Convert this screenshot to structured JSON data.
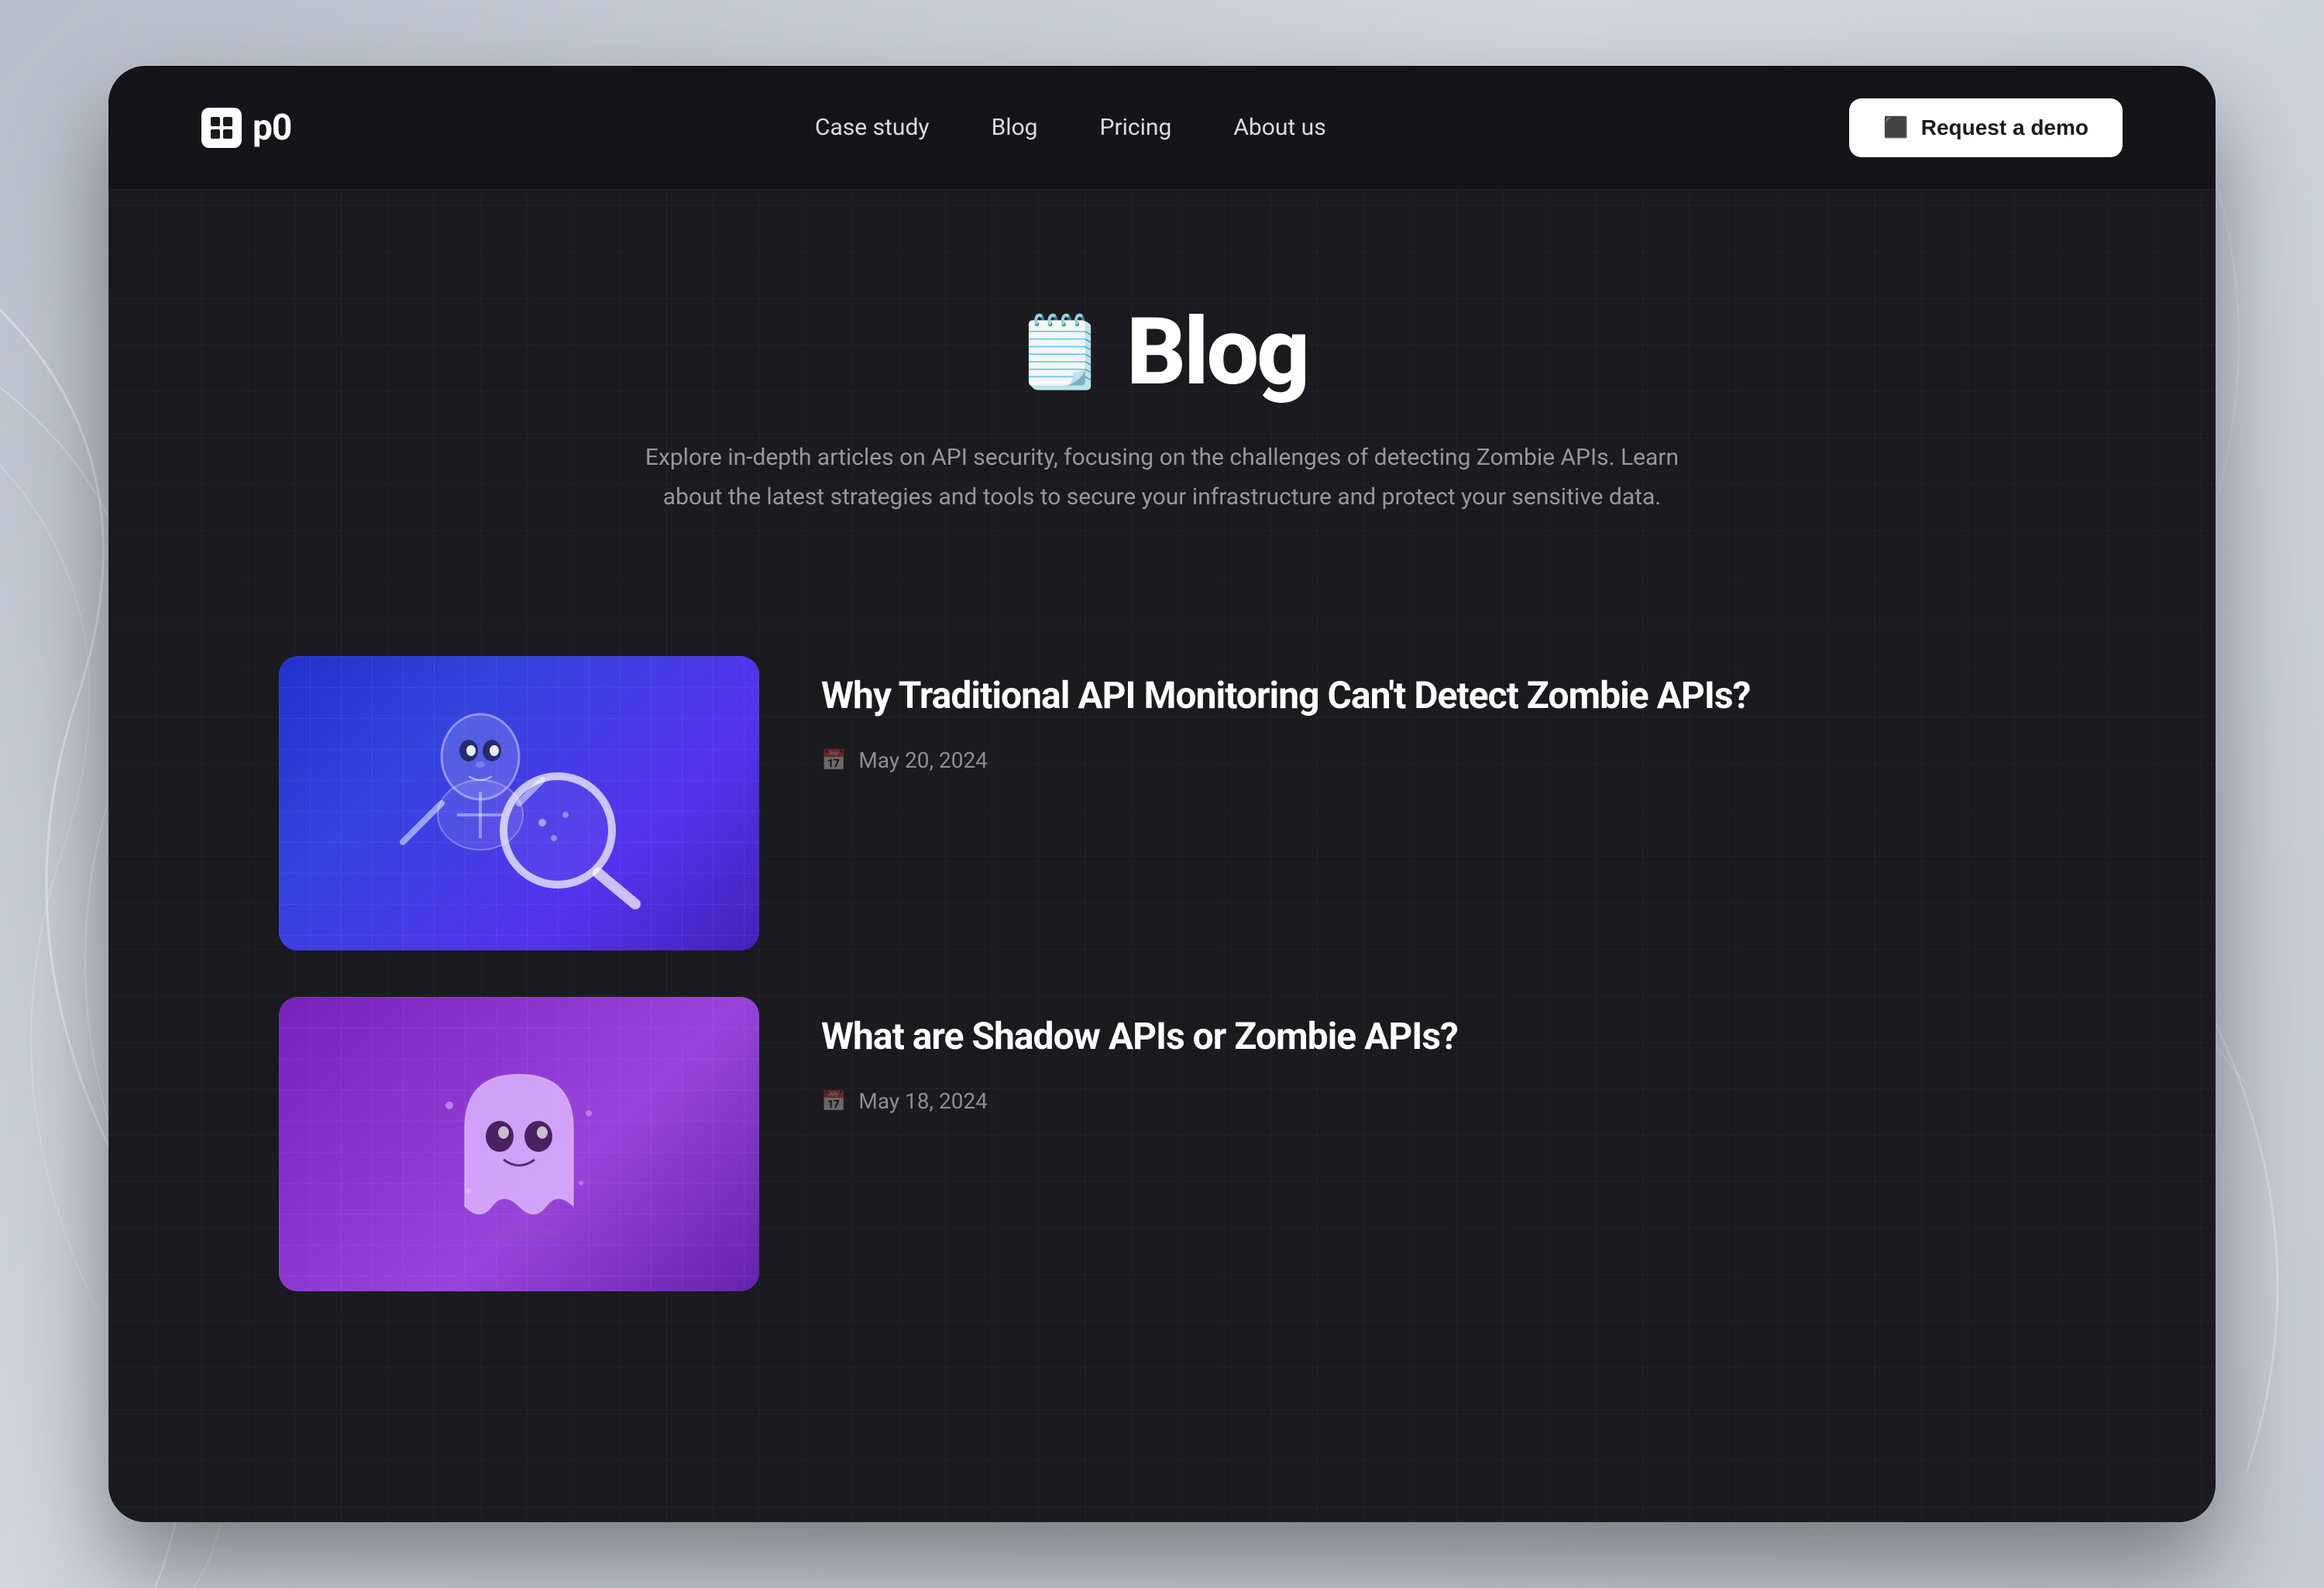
{
  "background": {
    "color": "#c8cdd8"
  },
  "browser": {
    "background": "#1a1a1f"
  },
  "navbar": {
    "logo_text": "p0",
    "links": [
      {
        "label": "Case study",
        "id": "case-study"
      },
      {
        "label": "Blog",
        "id": "blog"
      },
      {
        "label": "Pricing",
        "id": "pricing"
      },
      {
        "label": "About us",
        "id": "about-us"
      }
    ],
    "cta_label": "Request a demo"
  },
  "hero": {
    "icon": "📋",
    "title": "Blog",
    "subtitle": "Explore in-depth articles on API security, focusing on the challenges of detecting Zombie APIs. Learn about the latest strategies and tools to secure your infrastructure and protect your sensitive data."
  },
  "blog_posts": [
    {
      "id": "post-1",
      "title": "Why Traditional API Monitoring Can't Detect Zombie APIs?",
      "date": "May 20, 2024",
      "thumbnail_style": "blue"
    },
    {
      "id": "post-2",
      "title": "What are Shadow APIs or Zombie APIs?",
      "date": "May 18, 2024",
      "thumbnail_style": "purple"
    }
  ],
  "icons": {
    "calendar": "📅",
    "demo_btn": "⬜"
  }
}
